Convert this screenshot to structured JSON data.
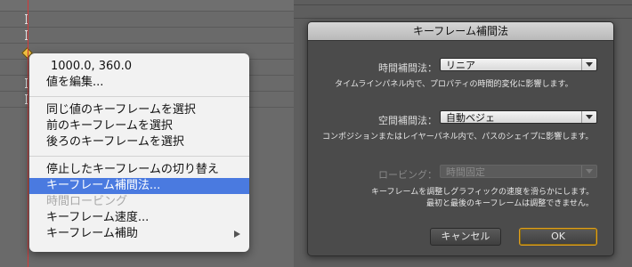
{
  "context_menu": {
    "value_readout": "1000.0, 360.0",
    "items": [
      {
        "label": "値を編集..."
      },
      {
        "label": "同じ値のキーフレームを選択"
      },
      {
        "label": "前のキーフレームを選択"
      },
      {
        "label": "後ろのキーフレームを選択"
      },
      {
        "label": "停止したキーフレームの切り替え"
      },
      {
        "label": "キーフレーム補間法..."
      },
      {
        "label": "時間ロービング"
      },
      {
        "label": "キーフレーム速度..."
      },
      {
        "label": "キーフレーム補助"
      }
    ]
  },
  "dialog": {
    "title": "キーフレーム補間法",
    "temporal": {
      "label": "時間補間法：",
      "value": "リニア",
      "description": "タイムラインパネル内で、プロパティの時間的変化に影響します。"
    },
    "spatial": {
      "label": "空間補間法：",
      "value": "自動ベジェ",
      "description": "コンポジションまたはレイヤーパネル内で、パスのシェイプに影響します。"
    },
    "roving": {
      "label": "ロービング：",
      "value": "時間固定",
      "description_line1": "キーフレームを調整しグラフィックの速度を滑らかにします。",
      "description_line2": "最初と最後のキーフレームは調整できません。"
    },
    "cancel_label": "キャンセル",
    "ok_label": "OK"
  },
  "colors": {
    "menu_highlight": "#4a7ae0",
    "playhead": "#d23a3a",
    "keyframe": "#f0c040",
    "ok_focus_ring": "#e0a020"
  }
}
